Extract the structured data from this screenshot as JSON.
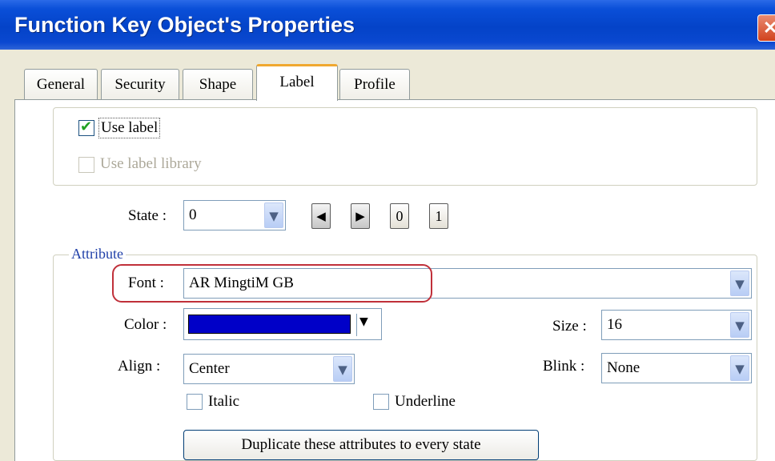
{
  "window": {
    "title": "Function Key Object's Properties"
  },
  "tabs": [
    {
      "label": "General"
    },
    {
      "label": "Security"
    },
    {
      "label": "Shape"
    },
    {
      "label": "Label",
      "active": true
    },
    {
      "label": "Profile"
    }
  ],
  "use_label": {
    "label": "Use label",
    "checked": true
  },
  "use_label_library": {
    "label": "Use label library",
    "checked": false,
    "enabled": false
  },
  "state": {
    "label": "State :",
    "value": "0",
    "buttons": [
      "0",
      "1"
    ]
  },
  "attribute": {
    "title": "Attribute",
    "font": {
      "label": "Font :",
      "value": "AR MingtiM GB"
    },
    "color": {
      "label": "Color :",
      "value": "#0000c8"
    },
    "size": {
      "label": "Size :",
      "value": "16"
    },
    "align": {
      "label": "Align :",
      "value": "Center"
    },
    "blink": {
      "label": "Blink :",
      "value": "None"
    },
    "italic": {
      "label": "Italic",
      "checked": false
    },
    "underline": {
      "label": "Underline",
      "checked": false
    },
    "duplicate_button": "Duplicate these attributes to every state"
  },
  "colors": {
    "titlebar": "#0443c8",
    "highlight": "#c0303a",
    "groupbox_title": "#1f3fa8"
  }
}
